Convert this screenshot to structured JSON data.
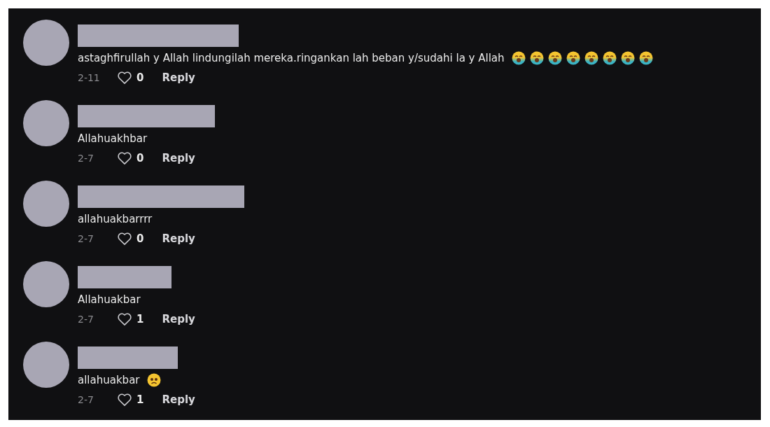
{
  "comments": [
    {
      "text": "astaghfirullah y Allah lindungilah mereka.ringankan lah beban y/sudahi la y Allah",
      "emojis": [
        {
          "kind": "crying"
        },
        {
          "kind": "crying"
        },
        {
          "kind": "crying"
        },
        {
          "kind": "crying"
        },
        {
          "kind": "crying"
        },
        {
          "kind": "crying"
        },
        {
          "kind": "crying"
        },
        {
          "kind": "crying"
        }
      ],
      "date": "2-11",
      "likes": "0",
      "reply": "Reply"
    },
    {
      "text": "Allahuakhbar",
      "date": "2-7",
      "likes": "0",
      "reply": "Reply"
    },
    {
      "text": "allahuakbarrrr",
      "date": "2-7",
      "likes": "0",
      "reply": "Reply"
    },
    {
      "text": "Allahuakbar",
      "date": "2-7",
      "likes": "1",
      "reply": "Reply"
    },
    {
      "text": "allahuakbar",
      "emojis": [
        {
          "kind": "frowning"
        }
      ],
      "date": "2-7",
      "likes": "1",
      "reply": "Reply"
    }
  ]
}
